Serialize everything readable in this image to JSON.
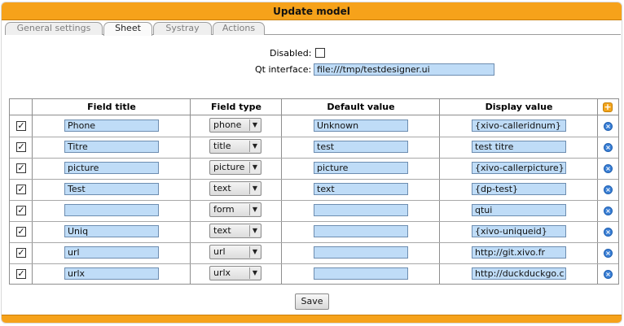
{
  "window": {
    "title": "Update model"
  },
  "tabs": [
    {
      "label": "General settings",
      "active": false
    },
    {
      "label": "Sheet",
      "active": true
    },
    {
      "label": "Systray",
      "active": false
    },
    {
      "label": "Actions",
      "active": false
    }
  ],
  "form": {
    "disabled_label": "Disabled:",
    "disabled_checked": false,
    "qt_interface_label": "Qt interface:",
    "qt_interface_value": "file:///tmp/testdesigner.ui"
  },
  "table": {
    "columns": [
      "Field title",
      "Field type",
      "Default value",
      "Display value"
    ],
    "add_icon": "add-icon",
    "delete_icon": "delete-icon",
    "rows": [
      {
        "checked": true,
        "title": "Phone",
        "type": "phone",
        "default": "Unknown",
        "display": "{xivo-calleridnum}"
      },
      {
        "checked": true,
        "title": "Titre",
        "type": "title",
        "default": "test",
        "display": "test titre"
      },
      {
        "checked": true,
        "title": "picture",
        "type": "picture",
        "default": "picture",
        "display": "{xivo-callerpicture}"
      },
      {
        "checked": true,
        "title": "Test",
        "type": "text",
        "default": "text",
        "display": "{dp-test}"
      },
      {
        "checked": true,
        "title": "",
        "type": "form",
        "default": "",
        "display": "qtui"
      },
      {
        "checked": true,
        "title": "Uniq",
        "type": "text",
        "default": "",
        "display": "{xivo-uniqueid}"
      },
      {
        "checked": true,
        "title": "url",
        "type": "url",
        "default": "",
        "display": "http://git.xivo.fr"
      },
      {
        "checked": true,
        "title": "urlx",
        "type": "urlx",
        "default": "",
        "display": "http://duckduckgo.c"
      }
    ]
  },
  "buttons": {
    "save_label": "Save"
  },
  "colors": {
    "accent": "#f6a21a",
    "field_bg": "#bfdcf7",
    "delete_icon": "#3b80d6"
  }
}
